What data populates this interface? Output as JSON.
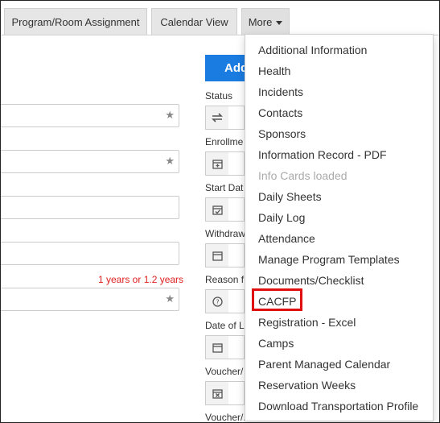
{
  "tabs": [
    {
      "label": "Program/Room Assignment"
    },
    {
      "label": "Calendar View"
    },
    {
      "label": "More"
    }
  ],
  "form": {
    "add_button_label": "Add",
    "age_text": "1 years or 1.2 years",
    "right_labels": [
      "Status",
      "Enrollme",
      "Start Dat",
      "Withdraw",
      "Reason f",
      "Date of L",
      "Voucher/",
      "Voucher/..."
    ]
  },
  "menu": {
    "items": [
      {
        "label": "Additional Information",
        "disabled": false
      },
      {
        "label": "Health",
        "disabled": false
      },
      {
        "label": "Incidents",
        "disabled": false
      },
      {
        "label": "Contacts",
        "disabled": false
      },
      {
        "label": "Sponsors",
        "disabled": false
      },
      {
        "label": "Information Record - PDF",
        "disabled": false
      },
      {
        "label": "Info Cards loaded",
        "disabled": true
      },
      {
        "label": "Daily Sheets",
        "disabled": false
      },
      {
        "label": "Daily Log",
        "disabled": false
      },
      {
        "label": "Attendance",
        "disabled": false
      },
      {
        "label": "Manage Program Templates",
        "disabled": false
      },
      {
        "label": "Documents/Checklist",
        "disabled": false
      },
      {
        "label": "CACFP",
        "disabled": false
      },
      {
        "label": "Registration - Excel",
        "disabled": false
      },
      {
        "label": "Camps",
        "disabled": false
      },
      {
        "label": "Parent Managed Calendar",
        "disabled": false
      },
      {
        "label": "Reservation Weeks",
        "disabled": false
      },
      {
        "label": "Download Transportation Profile",
        "disabled": false
      }
    ],
    "highlighted": "CACFP"
  },
  "colors": {
    "accent": "#1a7be0",
    "highlight": "#e01010",
    "error_text": "#e02020"
  },
  "icons": [
    "star-icon",
    "swap-icon",
    "calendar-plus-icon",
    "calendar-check-icon",
    "calendar-icon",
    "question-circle-icon",
    "calendar-x-icon",
    "caret-down-icon"
  ]
}
